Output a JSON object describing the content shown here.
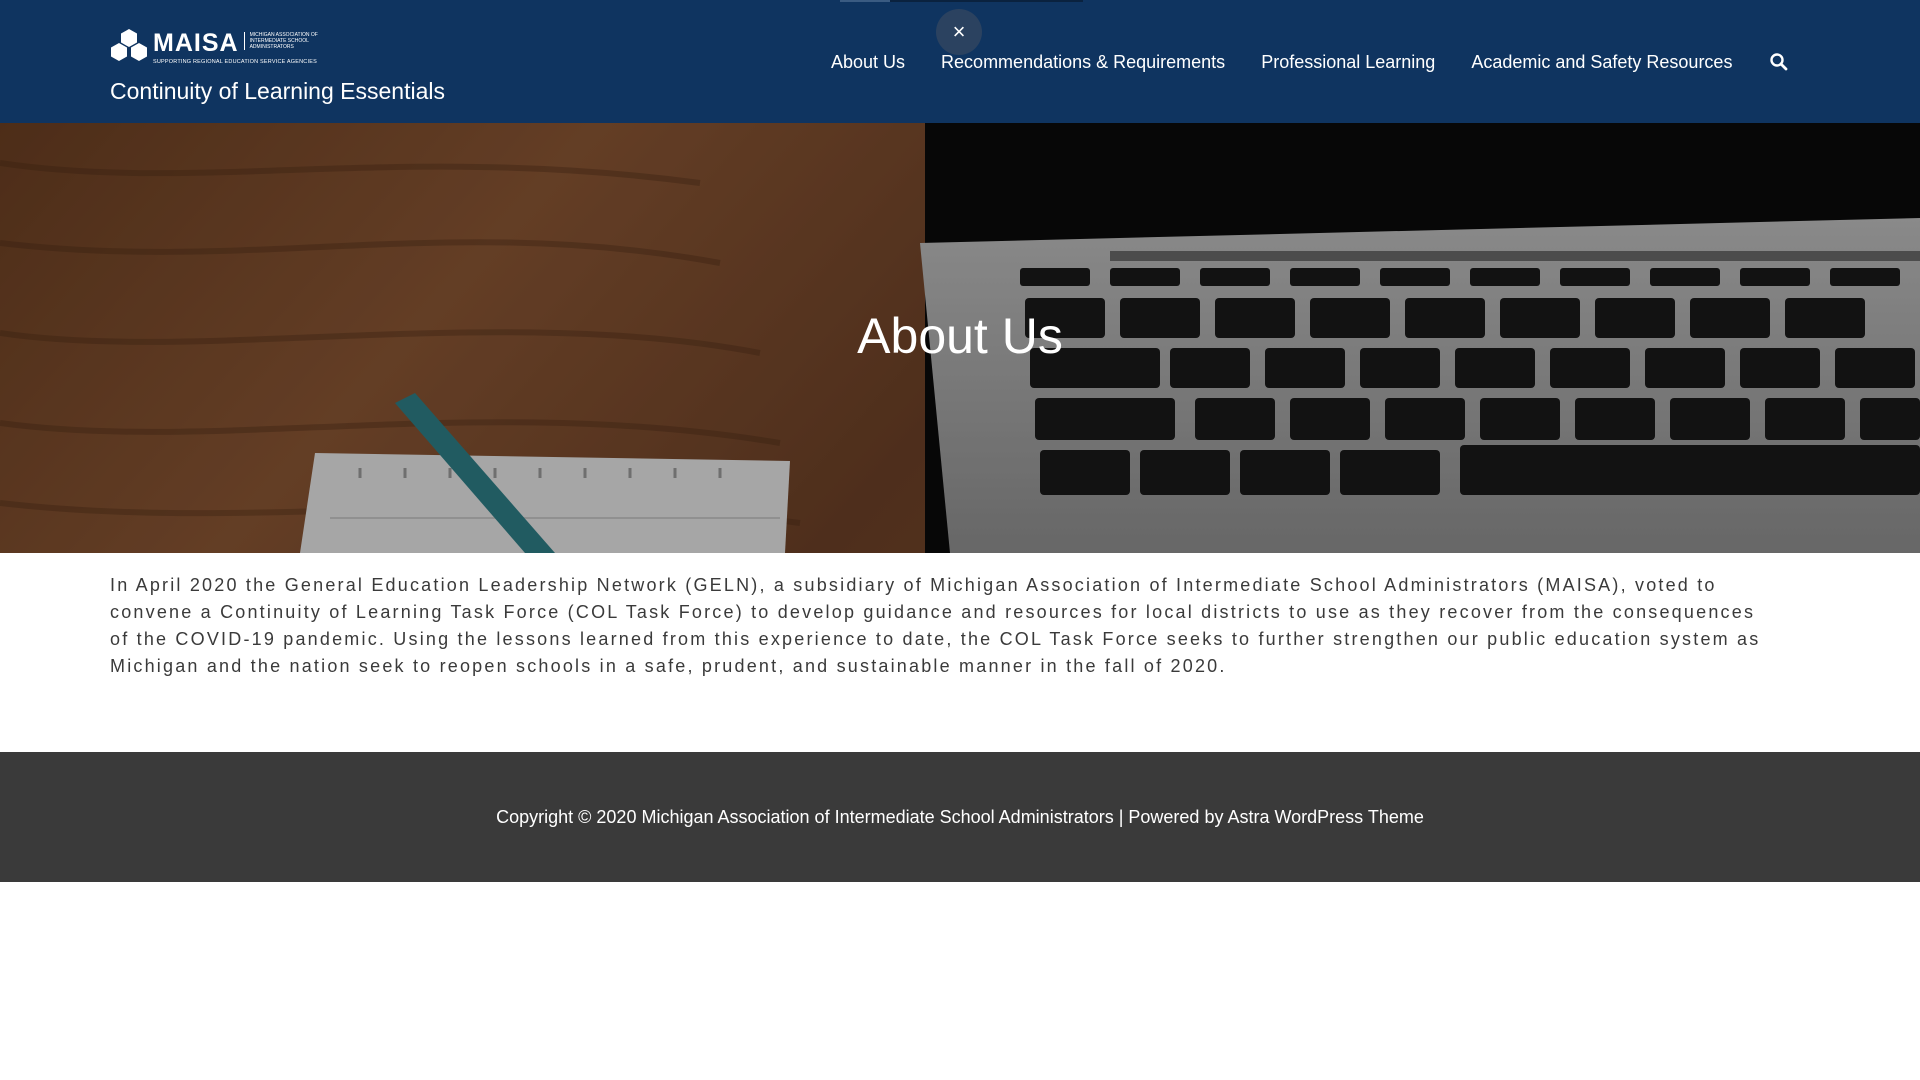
{
  "header": {
    "logo": {
      "name": "MAISA",
      "side_text": "Michigan Association of Intermediate School Administrators",
      "tagline": "Supporting Regional Education Service Agencies"
    },
    "site_title": "Continuity of Learning Essentials",
    "close_icon": "×",
    "nav": [
      {
        "label": "About Us"
      },
      {
        "label": "Recommendations & Requirements"
      },
      {
        "label": "Professional Learning"
      },
      {
        "label": "Academic and Safety Resources"
      }
    ],
    "search_icon": "search-icon",
    "colors": {
      "background": "#0f3460",
      "text": "#ffffff"
    }
  },
  "hero": {
    "title": "About Us"
  },
  "content": {
    "paragraph": "In April 2020 the General Education Leadership Network (GELN), a subsidiary of Michigan Association of Intermediate School Administrators (MAISA), voted to convene a Continuity of Learning Task Force (COL Task Force) to develop guidance and resources for local districts to use as they recover from the consequences of the COVID-19 pandemic. Using the lessons learned from this experience to date, the COL Task Force seeks to further strengthen our public education system as Michigan and the nation seek to reopen schools in a safe, prudent, and sustainable manner in the fall of 2020."
  },
  "footer": {
    "copyright_prefix": "Copyright © 2020 ",
    "org_name": "Michigan Association of Intermediate School Administrators",
    "powered_by": " | Powered by ",
    "theme_link": "Astra WordPress Theme",
    "colors": {
      "background": "#3a3a3a",
      "text": "#ffffff"
    }
  }
}
